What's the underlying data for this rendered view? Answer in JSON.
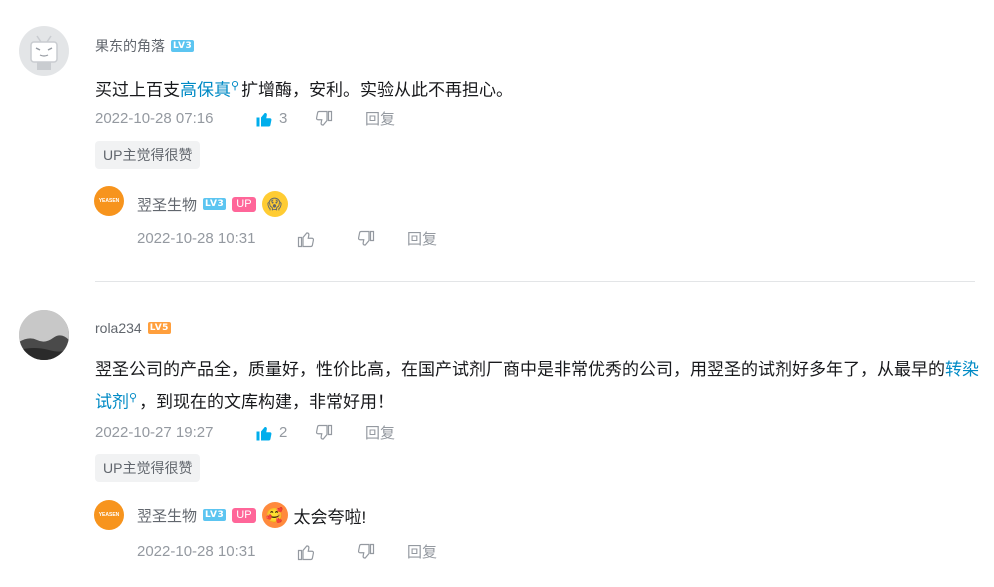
{
  "comments": [
    {
      "username": "果东的角落",
      "level": "LV3",
      "text_parts": [
        "买过上百支",
        "高保真",
        "扩增酶，安利。实验从此不再担心。"
      ],
      "time": "2022-10-28 07:16",
      "likes": "3",
      "reply_label": "回复",
      "tag": "UP主觉得很赞",
      "reply": {
        "username": "翌圣生物",
        "level": "LV3",
        "up_label": "UP",
        "avatar_text": "YEASEN",
        "text": "",
        "time": "2022-10-28 10:31",
        "reply_label": "回复"
      }
    },
    {
      "username": "rola234",
      "level": "LV5",
      "text_parts": [
        "翌圣公司的产品全，质量好，性价比高，在国产试剂厂商中是非常优秀的公司，用翌圣的试剂好多年了，从最早的",
        "转染试剂",
        "，到现在的文库构建，非常好用！"
      ],
      "time": "2022-10-27 19:27",
      "likes": "2",
      "reply_label": "回复",
      "tag": "UP主觉得很赞",
      "reply": {
        "username": "翌圣生物",
        "level": "LV3",
        "up_label": "UP",
        "avatar_text": "YEASEN",
        "text": "太会夸啦!",
        "time": "2022-10-28 10:31",
        "reply_label": "回复"
      }
    }
  ],
  "colors": {
    "link": "#008ac5",
    "like_active": "#00aeec",
    "up_tag": "#ff6699",
    "lv3": "#5cc5f1",
    "lv5": "#ff9f3d",
    "reply_avatar": "#f7941d"
  },
  "icons": [
    "tv-avatar-icon",
    "thumb-up-icon",
    "thumb-down-icon",
    "search-icon",
    "emoji-icon"
  ]
}
